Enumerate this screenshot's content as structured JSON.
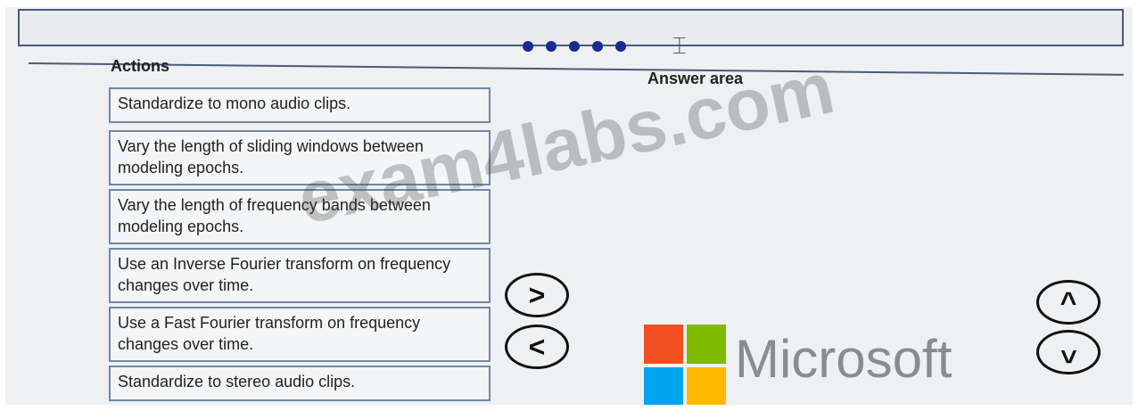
{
  "header": {
    "progress_dot_count": 5,
    "cursor_icon": "text-cursor-icon"
  },
  "actions": {
    "title": "Actions",
    "items": [
      "Standardize to mono audio clips.",
      "Vary the length of sliding windows between modeling epochs.",
      "Vary the length of frequency bands between modeling epochs.",
      "Use an Inverse Fourier transform on frequency changes over time.",
      "Use a Fast Fourier transform on frequency changes over time.",
      "Standardize to stereo audio clips."
    ]
  },
  "answer_area": {
    "title": "Answer area"
  },
  "controls": {
    "move_right_icon": "chevron-right-icon",
    "move_left_icon": "chevron-left-icon",
    "move_up_icon": "chevron-up-icon",
    "move_down_icon": "chevron-down-icon"
  },
  "branding": {
    "watermark": "exam4labs.com",
    "microsoft_word": "Microsoft",
    "logo_colors": [
      "#f25022",
      "#7fba00",
      "#00a4ef",
      "#ffb900"
    ]
  }
}
